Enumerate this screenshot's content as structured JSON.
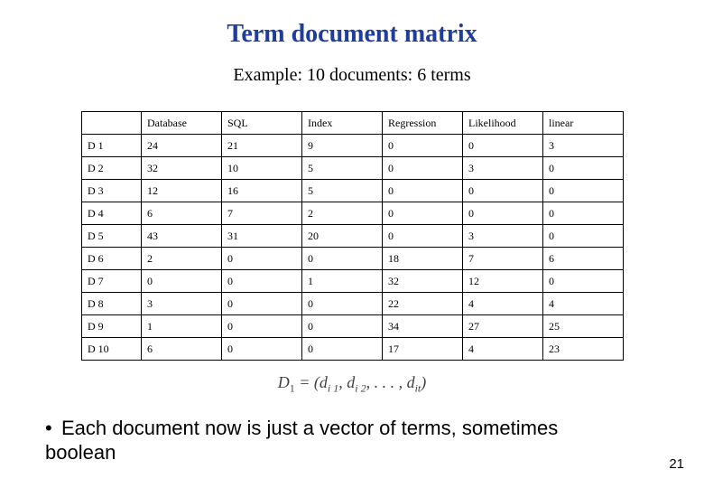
{
  "title": "Term document matrix",
  "subtitle": "Example:  10 documents:  6 terms",
  "table": {
    "columns": [
      "Database",
      "SQL",
      "Index",
      "Regression",
      "Likelihood",
      "linear"
    ],
    "rows": [
      {
        "label": "D 1",
        "values": [
          "24",
          "21",
          "9",
          "0",
          "0",
          "3"
        ]
      },
      {
        "label": "D 2",
        "values": [
          "32",
          "10",
          "5",
          "0",
          "3",
          "0"
        ]
      },
      {
        "label": "D 3",
        "values": [
          "12",
          "16",
          "5",
          "0",
          "0",
          "0"
        ]
      },
      {
        "label": "D 4",
        "values": [
          "6",
          "7",
          "2",
          "0",
          "0",
          "0"
        ]
      },
      {
        "label": "D 5",
        "values": [
          "43",
          "31",
          "20",
          "0",
          "3",
          "0"
        ]
      },
      {
        "label": "D 6",
        "values": [
          "2",
          "0",
          "0",
          "18",
          "7",
          "6"
        ]
      },
      {
        "label": "D 7",
        "values": [
          "0",
          "0",
          "1",
          "32",
          "12",
          "0"
        ]
      },
      {
        "label": "D 8",
        "values": [
          "3",
          "0",
          "0",
          "22",
          "4",
          "4"
        ]
      },
      {
        "label": "D 9",
        "values": [
          "1",
          "0",
          "0",
          "34",
          "27",
          "25"
        ]
      },
      {
        "label": "D 10",
        "values": [
          "6",
          "0",
          "0",
          "17",
          "4",
          "23"
        ]
      }
    ]
  },
  "formula": {
    "lhs": "D",
    "lhs_sub": "1",
    "eq": " = (",
    "terms": [
      {
        "base": "d",
        "sub": "i 1"
      },
      {
        "base": "d",
        "sub": "i 2"
      }
    ],
    "ellipsis": ", . . . , ",
    "last": {
      "base": "d",
      "sub": "it"
    },
    "close": ")"
  },
  "bullet": "Each document now is just a vector of terms, sometimes boolean",
  "page_number": "21",
  "chart_data": {
    "type": "table",
    "title": "Term document matrix",
    "columns": [
      "Database",
      "SQL",
      "Index",
      "Regression",
      "Likelihood",
      "linear"
    ],
    "row_labels": [
      "D 1",
      "D 2",
      "D 3",
      "D 4",
      "D 5",
      "D 6",
      "D 7",
      "D 8",
      "D 9",
      "D 10"
    ],
    "values": [
      [
        24,
        21,
        9,
        0,
        0,
        3
      ],
      [
        32,
        10,
        5,
        0,
        3,
        0
      ],
      [
        12,
        16,
        5,
        0,
        0,
        0
      ],
      [
        6,
        7,
        2,
        0,
        0,
        0
      ],
      [
        43,
        31,
        20,
        0,
        3,
        0
      ],
      [
        2,
        0,
        0,
        18,
        7,
        6
      ],
      [
        0,
        0,
        1,
        32,
        12,
        0
      ],
      [
        3,
        0,
        0,
        22,
        4,
        4
      ],
      [
        1,
        0,
        0,
        34,
        27,
        25
      ],
      [
        6,
        0,
        0,
        17,
        4,
        23
      ]
    ]
  }
}
